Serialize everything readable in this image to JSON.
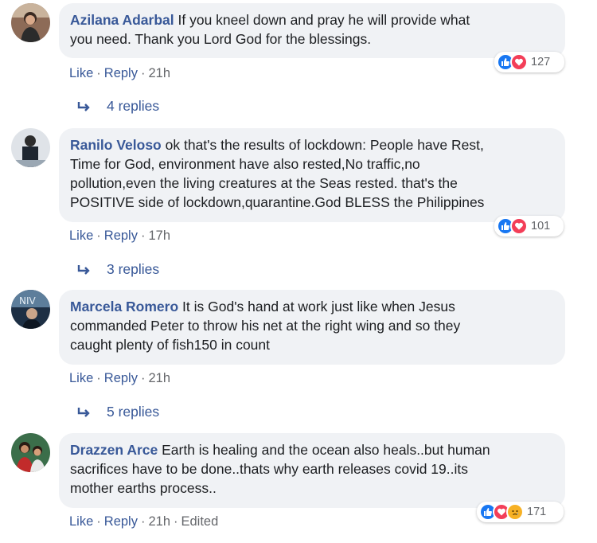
{
  "comments": [
    {
      "author": "Azilana Adarbal",
      "text_line1": "If you kneel down and pray he will provide what",
      "text_line2": "you need. Thank you Lord God for the blessings.",
      "like": "Like",
      "reply": "Reply",
      "time": "21h",
      "reaction_count": "127",
      "replies_label": "4 replies"
    },
    {
      "author": "Ranilo Veloso",
      "text_line1": "ok that's the results of lockdown: People have Rest,",
      "text_line2": "Time for God, environment have also rested,No traffic,no",
      "text_line3": "pollution,even the living creatures at the Seas rested. that's the",
      "text_line4": "POSITIVE side of lockdown,quarantine.God BLESS the Philippines",
      "like": "Like",
      "reply": "Reply",
      "time": "17h",
      "reaction_count": "101",
      "replies_label": "3 replies"
    },
    {
      "author": "Marcela Romero",
      "text_line1": "It is God's hand at work just like when Jesus",
      "text_line2": "commanded Peter to throw his net at the right wing and so they",
      "text_line3": "caught plenty of fish150 in count",
      "like": "Like",
      "reply": "Reply",
      "time": "21h",
      "replies_label": "5 replies"
    },
    {
      "author": "Drazzen Arce",
      "text_line1": "Earth is healing and the ocean also heals..but human",
      "text_line2": "sacrifices have to be done..thats why earth releases covid 19..its",
      "text_line3": "mother earths process..",
      "like": "Like",
      "reply": "Reply",
      "time": "21h",
      "edited": "Edited",
      "reaction_count": "171"
    }
  ],
  "separator": "·",
  "icons": {
    "like": "like-reaction-icon",
    "love": "love-reaction-icon",
    "sad": "sad-reaction-icon",
    "reply_arrow": "reply-arrow-icon"
  },
  "colors": {
    "author": "#385898",
    "bubble": "#f0f2f5",
    "like_blue": "#1877f2",
    "love_red": "#f33e58",
    "sad_yellow": "#f7b125"
  }
}
